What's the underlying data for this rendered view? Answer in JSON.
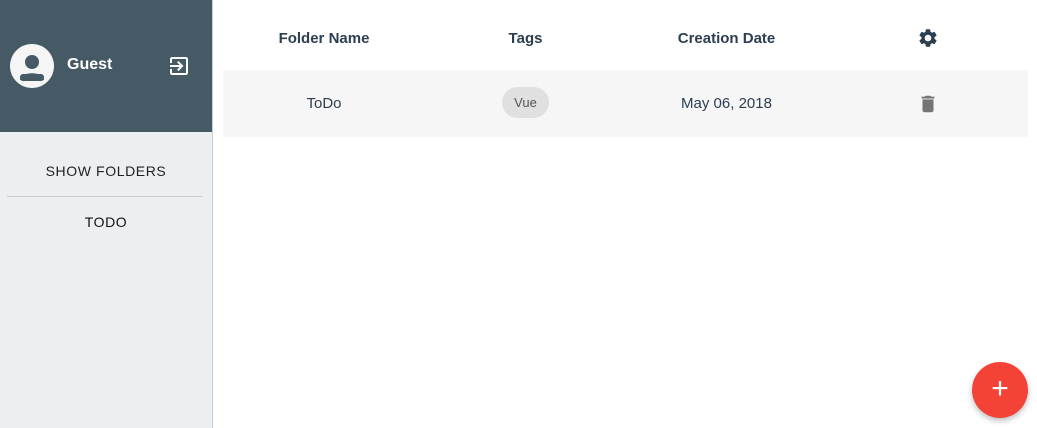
{
  "user": {
    "name": "Guest",
    "avatar_icon": "person-icon",
    "logout_icon": "exit-to-app-icon"
  },
  "sidebar": {
    "items": [
      {
        "label": "SHOW FOLDERS"
      },
      {
        "label": "TODO"
      }
    ]
  },
  "table": {
    "columns": [
      "Folder Name",
      "Tags",
      "Creation Date"
    ],
    "settings_icon": "gear-icon",
    "rows": [
      {
        "folder_name": "ToDo",
        "tags": [
          "Vue"
        ],
        "creation_date": "May 06, 2018",
        "action_icon": "trash-icon"
      }
    ]
  },
  "fab": {
    "label": "+",
    "icon": "plus-icon"
  },
  "colors": {
    "header_bg": "#455a64",
    "sidebar_bg": "#eceff1",
    "fab": "#f44336",
    "text": "#2c3e50",
    "row_bg": "#f6f6f6"
  }
}
